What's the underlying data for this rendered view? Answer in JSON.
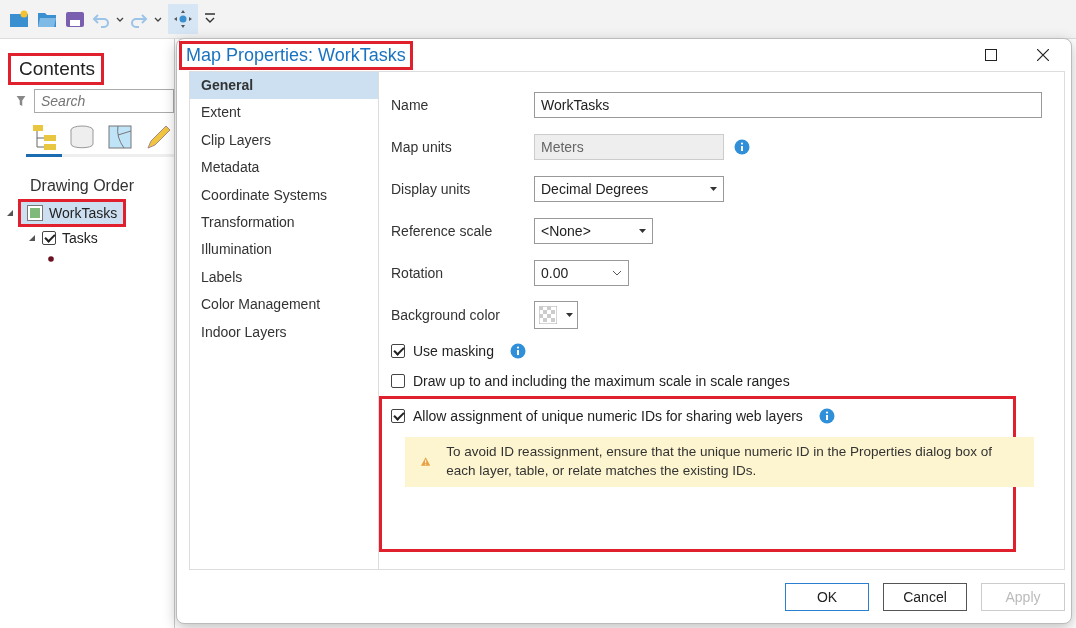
{
  "contents": {
    "title": "Contents",
    "highlighted": true,
    "search": {
      "placeholder": "Search"
    },
    "view_tabs": [
      {
        "selected": true
      },
      {
        "selected": false
      },
      {
        "selected": false
      },
      {
        "selected": false
      }
    ],
    "heading": "Drawing Order",
    "layers": [
      {
        "name": "WorkTasks",
        "selected": true,
        "highlighted": true,
        "expanded": true,
        "children": [
          {
            "name": "Tasks",
            "checked": true,
            "expanded": true
          }
        ]
      }
    ]
  },
  "dialog": {
    "title": "Map Properties: WorkTasks",
    "title_highlighted": true,
    "nav": [
      {
        "label": "General",
        "selected": true
      },
      {
        "label": "Extent",
        "selected": false
      },
      {
        "label": "Clip Layers",
        "selected": false
      },
      {
        "label": "Metadata",
        "selected": false
      },
      {
        "label": "Coordinate Systems",
        "selected": false
      },
      {
        "label": "Transformation",
        "selected": false
      },
      {
        "label": "Illumination",
        "selected": false
      },
      {
        "label": "Labels",
        "selected": false
      },
      {
        "label": "Color Management",
        "selected": false
      },
      {
        "label": "Indoor Layers",
        "selected": false
      }
    ],
    "fields": [
      {
        "label": "Name",
        "kind": "text",
        "value": "WorkTasks"
      },
      {
        "label": "Map units",
        "kind": "readonly",
        "value": "Meters",
        "info": true
      },
      {
        "label": "Display units",
        "kind": "dropdown",
        "value": "Decimal Degrees"
      },
      {
        "label": "Reference scale",
        "kind": "dropdown",
        "value": "<None>"
      },
      {
        "label": "Rotation",
        "kind": "combo",
        "value": "0.00"
      },
      {
        "label": "Background color",
        "kind": "color"
      }
    ],
    "options": [
      {
        "label": "Use masking",
        "checked": true,
        "info": true
      },
      {
        "label": "Draw up to and including the maximum scale in scale ranges",
        "checked": false
      }
    ],
    "id_section": {
      "highlighted": true,
      "option": {
        "label": "Allow assignment of unique numeric IDs for sharing web layers",
        "checked": true,
        "info": true
      },
      "warning": "To avoid ID reassignment, ensure that the unique numeric ID in the Properties dialog box of each layer, table, or relate matches the existing IDs."
    },
    "buttons": [
      {
        "label": "OK",
        "kind": "default"
      },
      {
        "label": "Cancel",
        "kind": "normal"
      },
      {
        "label": "Apply",
        "kind": "disabled"
      }
    ]
  }
}
